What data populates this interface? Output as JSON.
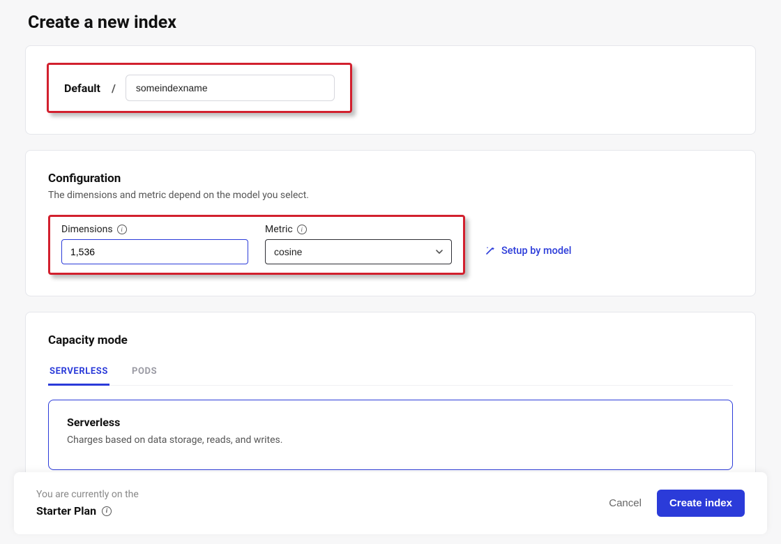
{
  "page": {
    "title": "Create a new index"
  },
  "name_section": {
    "prefix": "Default",
    "separator": "/",
    "input_value": "someindexname"
  },
  "configuration": {
    "title": "Configuration",
    "subtitle": "The dimensions and metric depend on the model you select.",
    "dimensions": {
      "label": "Dimensions",
      "value": "1,536"
    },
    "metric": {
      "label": "Metric",
      "value": "cosine"
    },
    "setup_by_model": "Setup by model"
  },
  "capacity": {
    "title": "Capacity mode",
    "tabs": [
      {
        "id": "serverless",
        "label": "SERVERLESS",
        "active": true
      },
      {
        "id": "pods",
        "label": "PODS",
        "active": false
      }
    ],
    "serverless": {
      "title": "Serverless",
      "description": "Charges based on data storage, reads, and writes."
    }
  },
  "footer": {
    "plan_intro": "You are currently on the",
    "plan_name": "Starter Plan",
    "cancel": "Cancel",
    "create": "Create index"
  },
  "colors": {
    "accent": "#2b3bd9",
    "highlight": "#d2202e"
  }
}
